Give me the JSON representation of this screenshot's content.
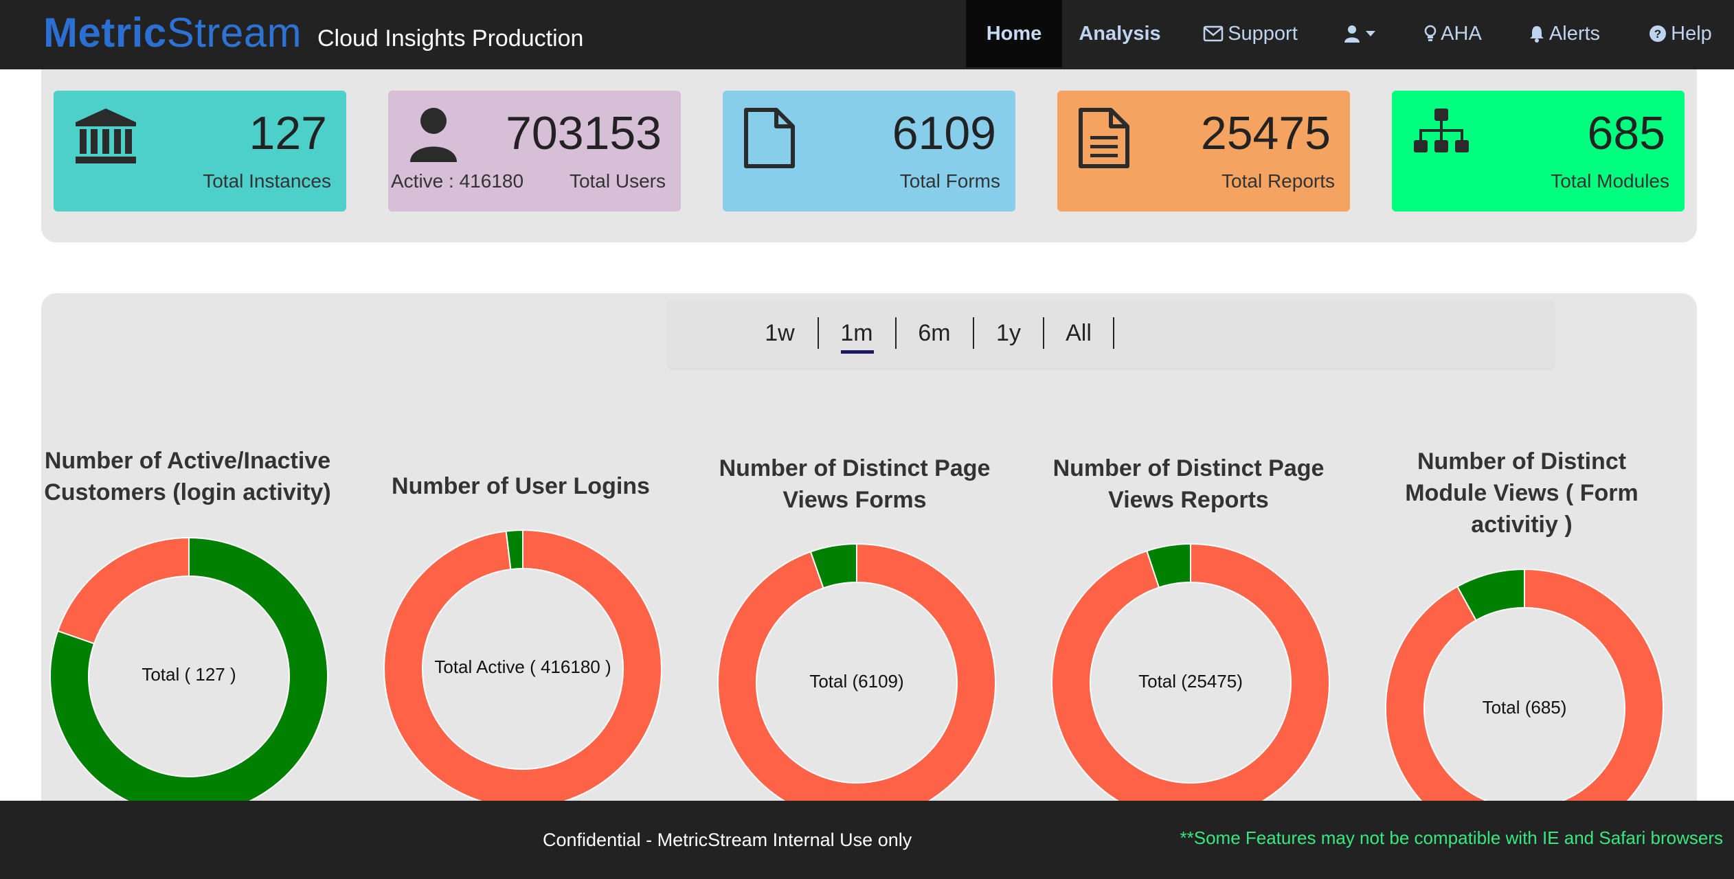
{
  "header": {
    "brand_bold": "Metric",
    "brand_light": "Stream",
    "app_name": "Cloud Insights Production",
    "nav": {
      "home": "Home",
      "analysis": "Analysis",
      "support": "Support",
      "aha": "AHA",
      "alerts": "Alerts",
      "help": "Help"
    }
  },
  "stats": [
    {
      "value": "127",
      "label": "Total Instances",
      "color": "#4dcfca",
      "icon": "bank-icon"
    },
    {
      "value": "703153",
      "label": "Total Users",
      "extra": "Active : 416180",
      "color": "#d8bfd8",
      "icon": "user-icon"
    },
    {
      "value": "6109",
      "label": "Total Forms",
      "color": "#87ceeb",
      "icon": "file-icon"
    },
    {
      "value": "25475",
      "label": "Total Reports",
      "color": "#f4a460",
      "icon": "file-text-icon"
    },
    {
      "value": "685",
      "label": "Total Modules",
      "color": "#00ff7f",
      "icon": "sitemap-icon"
    }
  ],
  "time_range": {
    "options": [
      "1w",
      "1m",
      "6m",
      "1y",
      "All"
    ],
    "selected": "1m"
  },
  "colors": {
    "active": "#008000",
    "inactive": "#ff6347",
    "underline": "#1a1a66"
  },
  "chart_data": [
    {
      "type": "pie",
      "title": "Number of Active/Inactive Customers (login activity)",
      "center_label": "Total ( 127 )",
      "slices": [
        {
          "value": 102,
          "color": "#008000"
        },
        {
          "value": 25,
          "color": "#ff6347"
        }
      ]
    },
    {
      "type": "pie",
      "title": "Number of User Logins",
      "center_label": "Total Active ( 416180 )",
      "slices": [
        {
          "value": 408180,
          "color": "#ff6347"
        },
        {
          "value": 8000,
          "color": "#008000"
        }
      ]
    },
    {
      "type": "pie",
      "title": "Number of Distinct Page Views Forms",
      "center_label": "Total (6109)",
      "slices": [
        {
          "value": 5780,
          "color": "#ff6347"
        },
        {
          "value": 329,
          "color": "#008000"
        }
      ]
    },
    {
      "type": "pie",
      "title": "Number of Distinct Page Views Reports",
      "center_label": "Total (25475)",
      "slices": [
        {
          "value": 24175,
          "color": "#ff6347"
        },
        {
          "value": 1300,
          "color": "#008000"
        }
      ]
    },
    {
      "type": "pie",
      "title": "Number of Distinct Module Views ( Form activitiy )",
      "center_label": "Total (685)",
      "slices": [
        {
          "value": 630,
          "color": "#ff6347"
        },
        {
          "value": 55,
          "color": "#008000"
        }
      ]
    }
  ],
  "footer": {
    "confidential": "Confidential - MetricStream Internal Use only",
    "warning": "**Some Features may not be compatible with IE and Safari browsers"
  }
}
